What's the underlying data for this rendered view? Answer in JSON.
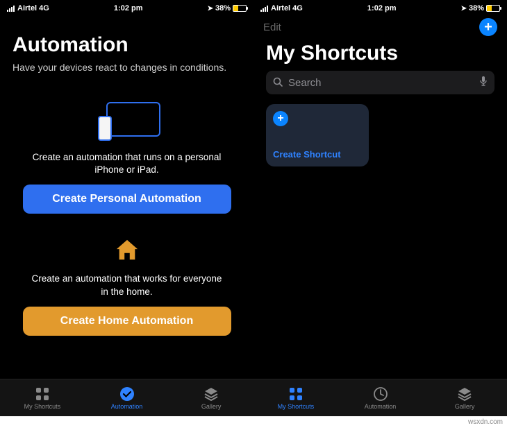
{
  "status": {
    "carrier": "Airtel 4G",
    "time": "1:02 pm",
    "battery_pct": "38%"
  },
  "left": {
    "title": "Automation",
    "subtitle": "Have your devices react to changes in conditions.",
    "personal_desc": "Create an automation that runs on a personal iPhone or iPad.",
    "personal_btn": "Create Personal Automation",
    "home_desc": "Create an automation that works for everyone in the home.",
    "home_btn": "Create Home Automation",
    "tabs": {
      "shortcuts": "My Shortcuts",
      "automation": "Automation",
      "gallery": "Gallery"
    }
  },
  "right": {
    "edit": "Edit",
    "title": "My Shortcuts",
    "search_placeholder": "Search",
    "card_label": "Create Shortcut",
    "tabs": {
      "shortcuts": "My Shortcuts",
      "automation": "Automation",
      "gallery": "Gallery"
    }
  },
  "watermark": "wsxdn.com"
}
